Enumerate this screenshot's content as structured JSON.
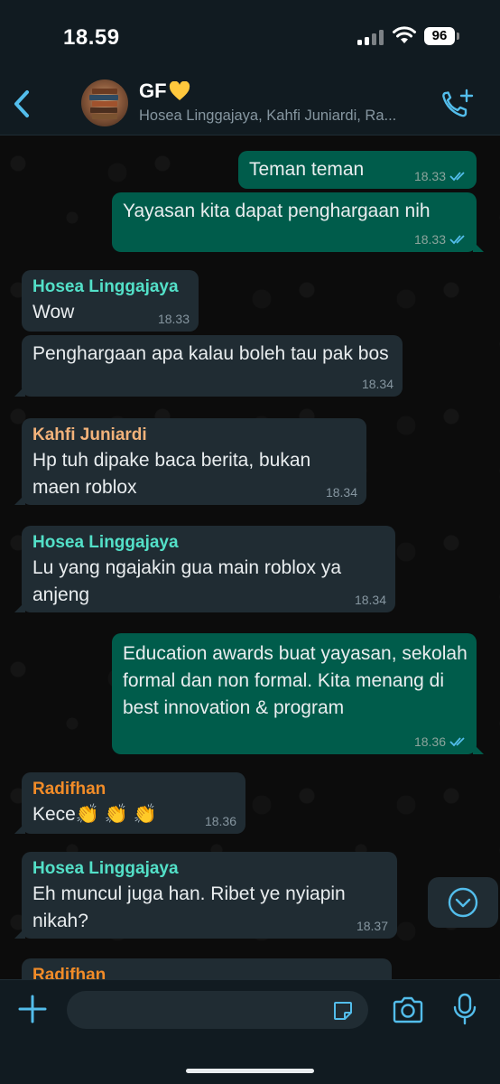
{
  "status_bar": {
    "time": "18.59",
    "battery": "96"
  },
  "header": {
    "title": "GF",
    "members": "Hosea Linggajaya, Kahfi Juniardi, Ra..."
  },
  "colors": {
    "accent": "#53bdeb",
    "outgoing_bubble": "#005c4b",
    "incoming_bubble": "#202c33",
    "sender_hosea": "#53e0c8",
    "sender_kahfi": "#f2b27a",
    "sender_radifhan": "#f28c28"
  },
  "messages": [
    {
      "direction": "out",
      "text": "Teman teman",
      "time": "18.33",
      "read": true
    },
    {
      "direction": "out",
      "text": "Yayasan kita dapat penghargaan nih",
      "time": "18.33",
      "read": true
    },
    {
      "direction": "in",
      "sender": "Hosea Linggajaya",
      "text": "Wow",
      "time": "18.33"
    },
    {
      "direction": "in",
      "text": "Penghargaan apa kalau boleh tau pak bos",
      "time": "18.34"
    },
    {
      "direction": "in",
      "sender": "Kahfi Juniardi",
      "text": "Hp tuh dipake baca berita, bukan maen roblox",
      "time": "18.34"
    },
    {
      "direction": "in",
      "sender": "Hosea Linggajaya",
      "text": "Lu yang ngajakin gua main roblox ya anjeng",
      "time": "18.34"
    },
    {
      "direction": "out",
      "text": "Education awards buat yayasan, sekolah formal dan non formal. Kita menang di best innovation & program",
      "time": "18.36",
      "read": true
    },
    {
      "direction": "in",
      "sender": "Radifhan",
      "text": "Kece👏 👏 👏",
      "time": "18.36"
    },
    {
      "direction": "in",
      "sender": "Hosea Linggajaya",
      "text": "Eh muncul juga han. Ribet ye nyiapin nikah?",
      "time": "18.37"
    },
    {
      "direction": "in",
      "sender": "Radifhan",
      "text": "",
      "time": ""
    }
  ],
  "icons": {
    "back": "chevron-left-icon",
    "add_call": "phone-plus-icon",
    "scroll_down": "chevron-down-circle-icon",
    "attach": "plus-icon",
    "sticker": "sticker-icon",
    "camera": "camera-icon",
    "mic": "mic-icon"
  },
  "composer": {
    "value": "",
    "placeholder": ""
  }
}
